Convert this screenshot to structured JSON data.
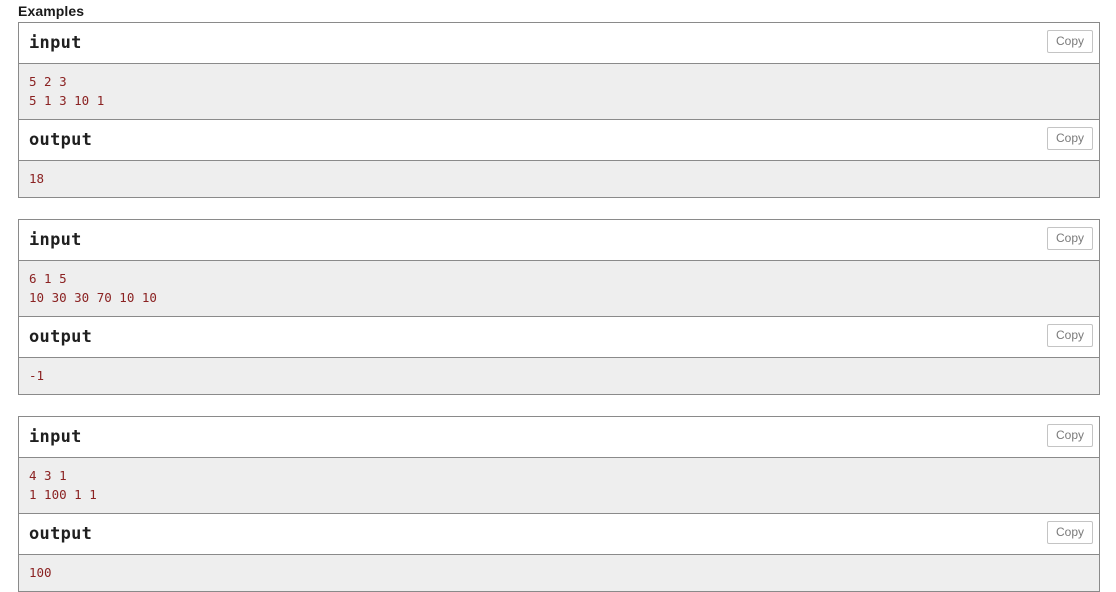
{
  "section": {
    "title": "Examples"
  },
  "ui": {
    "copy_label": "Copy",
    "input_title": "input",
    "output_title": "output",
    "accent_text_color": "#8b2222",
    "panel_background": "#eeeeee",
    "border_color": "#8a8a8a",
    "copy_text_color": "#7a7a7a"
  },
  "examples": [
    {
      "input_title": "input",
      "input_text": "5 2 3\n5 1 3 10 1",
      "input_copy_label": "Copy",
      "output_title": "output",
      "output_text": "18",
      "output_copy_label": "Copy"
    },
    {
      "input_title": "input",
      "input_text": "6 1 5\n10 30 30 70 10 10",
      "input_copy_label": "Copy",
      "output_title": "output",
      "output_text": "-1",
      "output_copy_label": "Copy"
    },
    {
      "input_title": "input",
      "input_text": "4 3 1\n1 100 1 1",
      "input_copy_label": "Copy",
      "output_title": "output",
      "output_text": "100",
      "output_copy_label": "Copy"
    }
  ]
}
